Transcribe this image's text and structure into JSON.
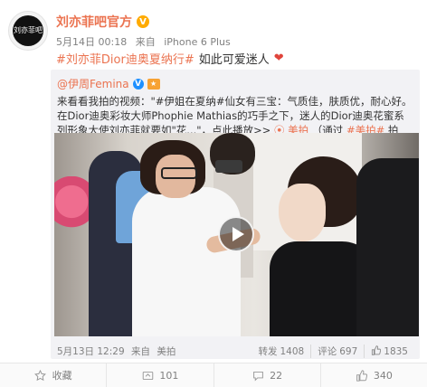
{
  "post": {
    "username": "刘亦菲吧官方",
    "avatar_text": "刘亦菲吧",
    "date": "5月14日 00:18",
    "source_prefix": "来自",
    "source_device": "iPhone 6 Plus",
    "hashtag": "#刘亦菲Dior迪奥夏纳行#",
    "text": "如此可爱迷人",
    "heart": "❤"
  },
  "repost": {
    "username": "@伊周Femina",
    "text": "来看看我拍的视频：\"#伊姐在夏纳#仙女有三宝：气质佳，肤质优，耐心好。在Dior迪奥彩妆大师Phophie Mathias的巧手之下，迷人的Dior迪奥花蜜系列形象大使刘亦菲就要如\"花...\"，点此播放>>",
    "link_icon": "⦿",
    "app_name": "美拍",
    "app_note": "（通过",
    "app_tag": "#美拍#",
    "app_note_end": "拍摄）",
    "date": "5月13日 12:29",
    "source_prefix": "来自",
    "source_app": "美拍",
    "forward_label": "转发",
    "forward_count": "1408",
    "comment_label": "评论",
    "comment_count": "697",
    "like_count": "1835"
  },
  "actions": {
    "collect_label": "收藏",
    "forward_count": "101",
    "comment_count": "22",
    "like_count": "340"
  },
  "colors": {
    "accent": "#eb7350",
    "verified_orange": "#ffab00",
    "verified_blue": "#1e90ff",
    "muted": "#808080",
    "repost_bg": "#f2f2f5"
  },
  "icons": {
    "verified": "verified-badge-icon",
    "play": "play-icon",
    "star": "star-icon",
    "forward": "forward-icon",
    "comment": "comment-icon",
    "like": "thumbs-up-icon"
  }
}
